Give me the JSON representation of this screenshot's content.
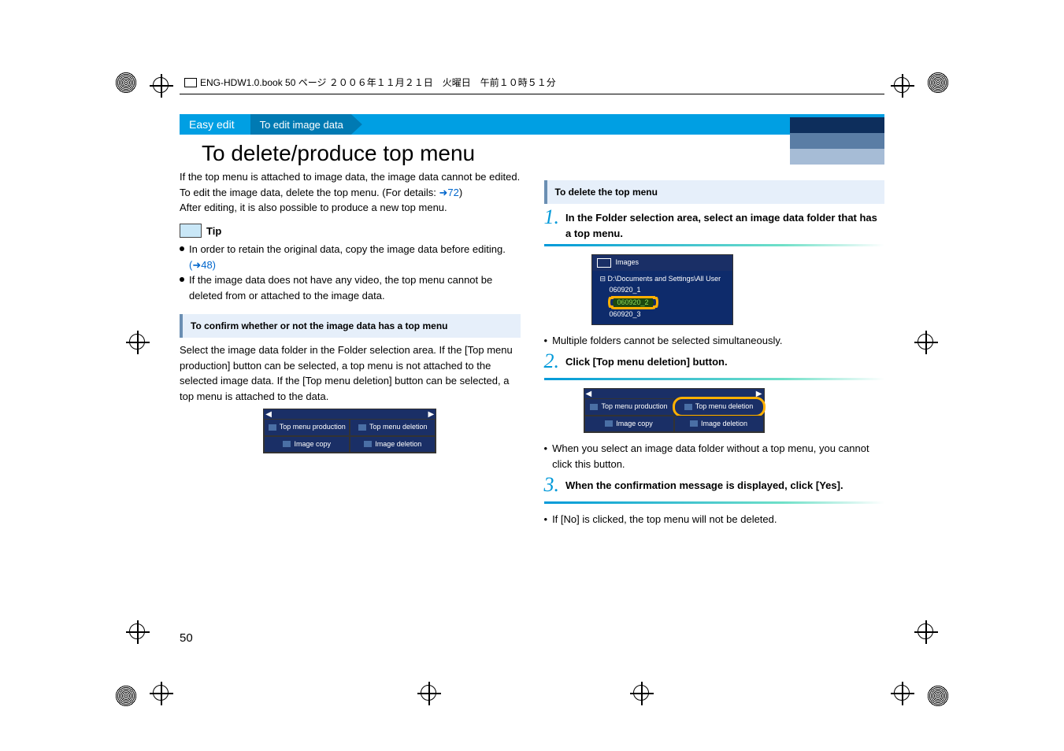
{
  "header_line": "ENG-HDW1.0.book  50 ページ  ２００６年１１月２１日　火曜日　午前１０時５１分",
  "banner": {
    "tab": "Easy edit",
    "subtab": "To edit image data"
  },
  "title": "To delete/produce top menu",
  "left": {
    "p1a": "If the top menu is attached to image data, the image data cannot be edited. To edit the image data, delete the top menu. (For details: ",
    "p1_link": "➜72",
    "p1b": ")",
    "p2": "After editing, it is also possible to produce a new top menu.",
    "tip_label": "Tip",
    "tip1a": "In order to retain the original data, copy the image data before editing. ",
    "tip1_link": "(➜48)",
    "tip2": "If the image data does not have any video, the top menu cannot be deleted from or attached to the image data.",
    "sub_head": "To confirm whether or not the image data has a top menu",
    "p3": "Select the image data folder in the Folder selection area. If the [Top menu production] button can be selected, a top menu is not attached to the selected image data. If the [Top menu deletion] button can be selected, a top menu is attached to the data."
  },
  "right": {
    "sub_head": "To delete the top menu",
    "step1": "In the Folder selection area, select an image data folder that has a top menu.",
    "folders": {
      "header": "Images",
      "root": "D:\\Documents and Settings\\All User",
      "n1": "060920_1",
      "n2": "060920_2",
      "n3": "060920_3"
    },
    "bullet1": "Multiple folders cannot be selected simultaneously.",
    "step2": "Click [Top menu deletion] button.",
    "bullet2": "When you select an image data folder without a top menu, you cannot click this button.",
    "step3": "When the confirmation message is displayed, click [Yes].",
    "bullet3": "If [No] is clicked, the top menu will not be deleted."
  },
  "mini_buttons": {
    "b1": "Top menu production",
    "b2": "Top menu deletion",
    "b3": "Image copy",
    "b4": "Image deletion"
  },
  "page_number": "50"
}
